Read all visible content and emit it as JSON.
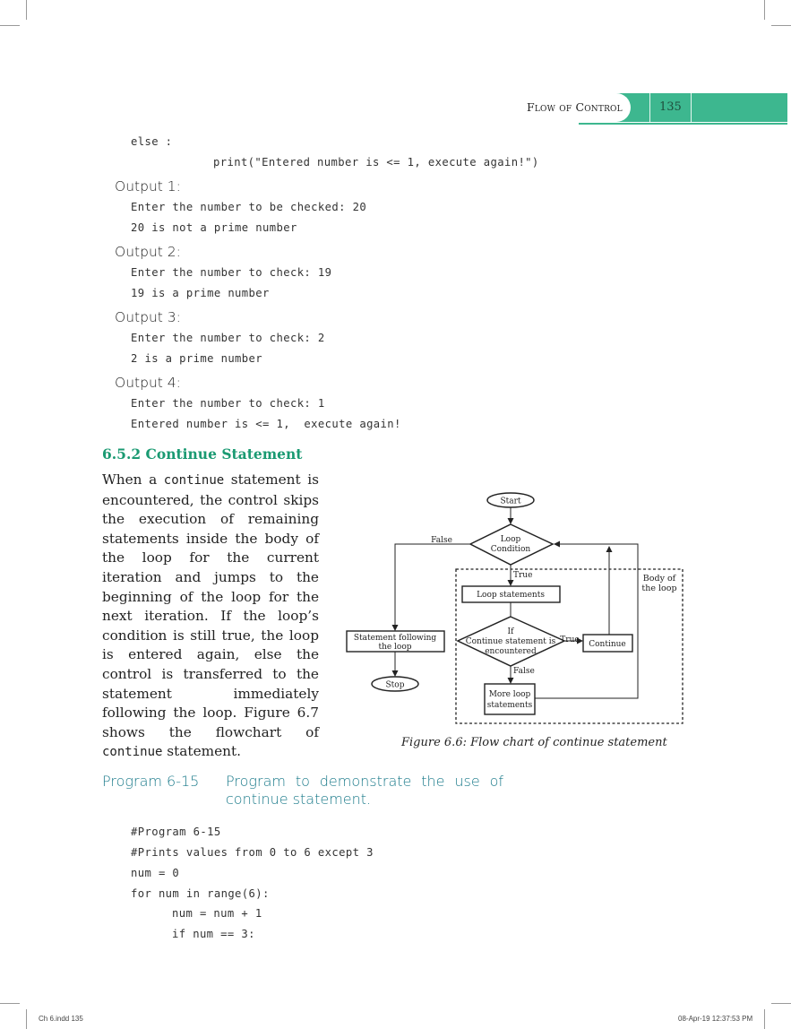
{
  "header": {
    "chapter_title": "Flow of Control",
    "page_number": "135",
    "accent_color": "#3db78f"
  },
  "code_top": [
    {
      "indent": 0,
      "text": "else :"
    },
    {
      "indent": 1,
      "text": "print(\"Entered number is <= 1, execute again!\")"
    }
  ],
  "outputs": [
    {
      "label": "Output 1:",
      "lines": [
        "Enter the number to be checked: 20",
        "20 is not a prime number"
      ]
    },
    {
      "label": "Output 2:",
      "lines": [
        "Enter the number to check: 19",
        "19 is a prime number"
      ]
    },
    {
      "label": "Output 3:",
      "lines": [
        "Enter the number to check: 2",
        "2 is a prime number"
      ]
    },
    {
      "label": "Output 4:",
      "lines": [
        "Enter the number to check: 1",
        "Entered number is <= 1,  execute again!"
      ]
    }
  ],
  "section": {
    "heading": "6.5.2 Continue Statement",
    "para_part1": "When a ",
    "para_keyword1": "continue",
    "para_part2": " statement is encountered, the control skips the execution of remaining statements inside the body of the loop for the current iteration and jumps to the beginning of the loop for the next iteration. If the loop’s condition is still true, the loop is entered again, else the control is transferred to the statement immediately following the loop. Figure 6.7 shows the flowchart of ",
    "para_keyword2": "continue",
    "para_part3": " statement."
  },
  "flowchart": {
    "start": "Start",
    "condition_line1": "Loop",
    "condition_line2": "Condition",
    "false_label": "False",
    "true_label": "True",
    "loop_statements": "Loop statements",
    "body_label_line1": "Body of",
    "body_label_line2": "the loop",
    "if_line1": "If",
    "if_line2": "Continue statement is",
    "if_line3": "encountered",
    "if_true": "True",
    "if_false": "False",
    "continue_box": "Continue",
    "more_line1": "More loop",
    "more_line2": "statements",
    "following_line1": "Statement following",
    "following_line2": "the loop",
    "stop": "Stop",
    "caption": "Figure 6.6: Flow chart of continue statement"
  },
  "program": {
    "label": "Program 6-15",
    "title": "Program to demonstrate the use of continue statement.",
    "accent_color": "#1a7a8a",
    "code": [
      {
        "indent": 0,
        "text": "#Program 6-15"
      },
      {
        "indent": 0,
        "text": "#Prints values from 0 to 6 except 3"
      },
      {
        "indent": 0,
        "text": "num = 0"
      },
      {
        "indent": 0,
        "text": "for num in range(6):"
      },
      {
        "indent": 1,
        "text": "num = num + 1"
      },
      {
        "indent": 1,
        "text": "if num == 3:"
      }
    ]
  },
  "footer": {
    "left": "Ch 6.indd   135",
    "right": "08-Apr-19   12:37:53 PM"
  }
}
